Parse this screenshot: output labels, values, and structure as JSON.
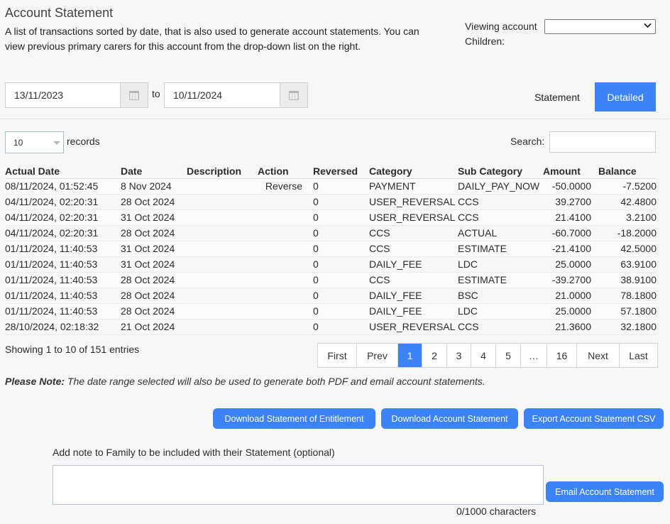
{
  "header": {
    "title": "Account Statement",
    "description": "A list of transactions sorted by date, that is also used to generate account statements. You can view previous primary carers for this account from the drop-down list on the right.",
    "viewing_account_label": "Viewing account",
    "viewing_account_value": "",
    "children_label": "Children:"
  },
  "date_range": {
    "from": "13/11/2023",
    "to_label": "to",
    "to": "10/11/2024"
  },
  "view_toggle": {
    "statement_label": "Statement",
    "detailed_label": "Detailed",
    "active": "Detailed",
    "active_color": "#3b83f6"
  },
  "table_controls": {
    "page_length": "10",
    "records_label": "records",
    "search_label": "Search:",
    "search_value": ""
  },
  "table": {
    "columns": [
      "Actual Date",
      "Date",
      "Description",
      "Action",
      "Reversed",
      "Category",
      "Sub Category",
      "Amount",
      "Balance"
    ],
    "rows": [
      [
        "08/11/2024, 01:52:45",
        "8 Nov 2024",
        "",
        "Reverse",
        "0",
        "PAYMENT",
        "DAILY_PAY_NOW",
        "-50.0000",
        "-7.5200"
      ],
      [
        "04/11/2024, 02:20:31",
        "28 Oct 2024",
        "",
        "",
        "0",
        "USER_REVERSAL",
        "CCS",
        "39.2700",
        "42.4800"
      ],
      [
        "04/11/2024, 02:20:31",
        "31 Oct 2024",
        "",
        "",
        "0",
        "USER_REVERSAL",
        "CCS",
        "21.4100",
        "3.2100"
      ],
      [
        "04/11/2024, 02:20:31",
        "28 Oct 2024",
        "",
        "",
        "0",
        "CCS",
        "ACTUAL",
        "-60.7000",
        "-18.2000"
      ],
      [
        "01/11/2024, 11:40:53",
        "31 Oct 2024",
        "",
        "",
        "0",
        "CCS",
        "ESTIMATE",
        "-21.4100",
        "42.5000"
      ],
      [
        "01/11/2024, 11:40:53",
        "31 Oct 2024",
        "",
        "",
        "0",
        "DAILY_FEE",
        "LDC",
        "25.0000",
        "63.9100"
      ],
      [
        "01/11/2024, 11:40:53",
        "28 Oct 2024",
        "",
        "",
        "0",
        "CCS",
        "ESTIMATE",
        "-39.2700",
        "38.9100"
      ],
      [
        "01/11/2024, 11:40:53",
        "28 Oct 2024",
        "",
        "",
        "0",
        "DAILY_FEE",
        "BSC",
        "21.0000",
        "78.1800"
      ],
      [
        "01/11/2024, 11:40:53",
        "28 Oct 2024",
        "",
        "",
        "0",
        "DAILY_FEE",
        "LDC",
        "25.0000",
        "57.1800"
      ],
      [
        "28/10/2024, 02:18:32",
        "21 Oct 2024",
        "",
        "",
        "0",
        "USER_REVERSAL",
        "CCS",
        "21.3600",
        "32.1800"
      ]
    ]
  },
  "pagination": {
    "info": "Showing 1 to 10 of 151 entries",
    "pages": [
      "First",
      "Prev",
      "1",
      "2",
      "3",
      "4",
      "5",
      "…",
      "16",
      "Next",
      "Last"
    ],
    "active_page": "1"
  },
  "note": {
    "bold": "Please Note:",
    "text": " The date range selected will also be used to generate both PDF and email account statements."
  },
  "actions": {
    "download_entitlement": "Download Statement of Entitlement",
    "download_account": "Download Account Statement",
    "export_csv": "Export Account Statement CSV"
  },
  "email": {
    "note_label": "Add note to Family to be included with their Statement (optional)",
    "note_value": "",
    "char_count": "0/1000 characters",
    "send_label": "Email Account Statement"
  },
  "icons": {
    "calendar": "calendar-icon",
    "dropdown": "chevron-down-icon"
  }
}
